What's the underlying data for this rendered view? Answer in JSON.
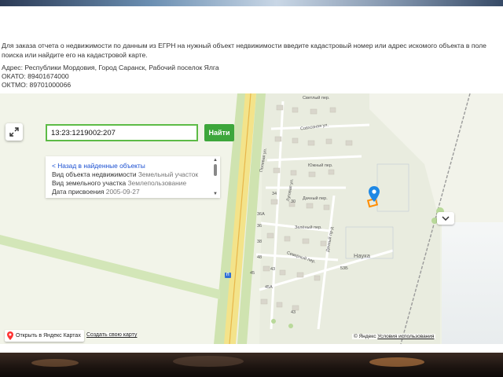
{
  "intro_text": "Для заказа отчета о недвижимости по данным из ЕГРН на нужный объект недвижимости введите кадастровый номер или адрес искомого объекта в поле поиска или найдите его на кадастровой карте.",
  "address": "Адрес: Республики Мордовия, Город Саранск, Рабочий поселок Ялга",
  "okato": "ОКАТО: 89401674000",
  "oktmo": "ОКТМО: 89701000066",
  "search": {
    "value": "13:23:1219002:207",
    "button_label": "Найти"
  },
  "info_card": {
    "back_link": "< Назад в найденные объекты",
    "rows": [
      {
        "label": "Вид объекта недвижимости",
        "value": "Земельный участок"
      },
      {
        "label": "Вид земельного участка",
        "value": "Землепользование"
      },
      {
        "label": "Дата присвоения",
        "value": "2005-09-27"
      }
    ]
  },
  "map": {
    "streets": [
      "Светлый пер.",
      "Совхозная ул.",
      "Полевая ул.",
      "Луговая ул.",
      "Южный пер.",
      "Дачный пер.",
      "Зелёный пер.",
      "Дачный пр-д",
      "Северный пер."
    ],
    "house_numbers": [
      "34",
      "30",
      "36А",
      "36",
      "38",
      "48",
      "45",
      "43",
      "45А",
      "53Б",
      "43"
    ],
    "road_number": "П",
    "place_label": "Наука",
    "open_in_yandex": "Открыть в Яндекс Картах",
    "create_map": "Создать свою карту",
    "copyright": "© Яндекс",
    "terms": "Условия использования",
    "marker_color": "#1e88e5",
    "plot_color": "#ff8c00"
  },
  "icons": [
    "expand-icon",
    "chevron-down-icon",
    "location-pin-icon",
    "yandex-pin-icon"
  ]
}
